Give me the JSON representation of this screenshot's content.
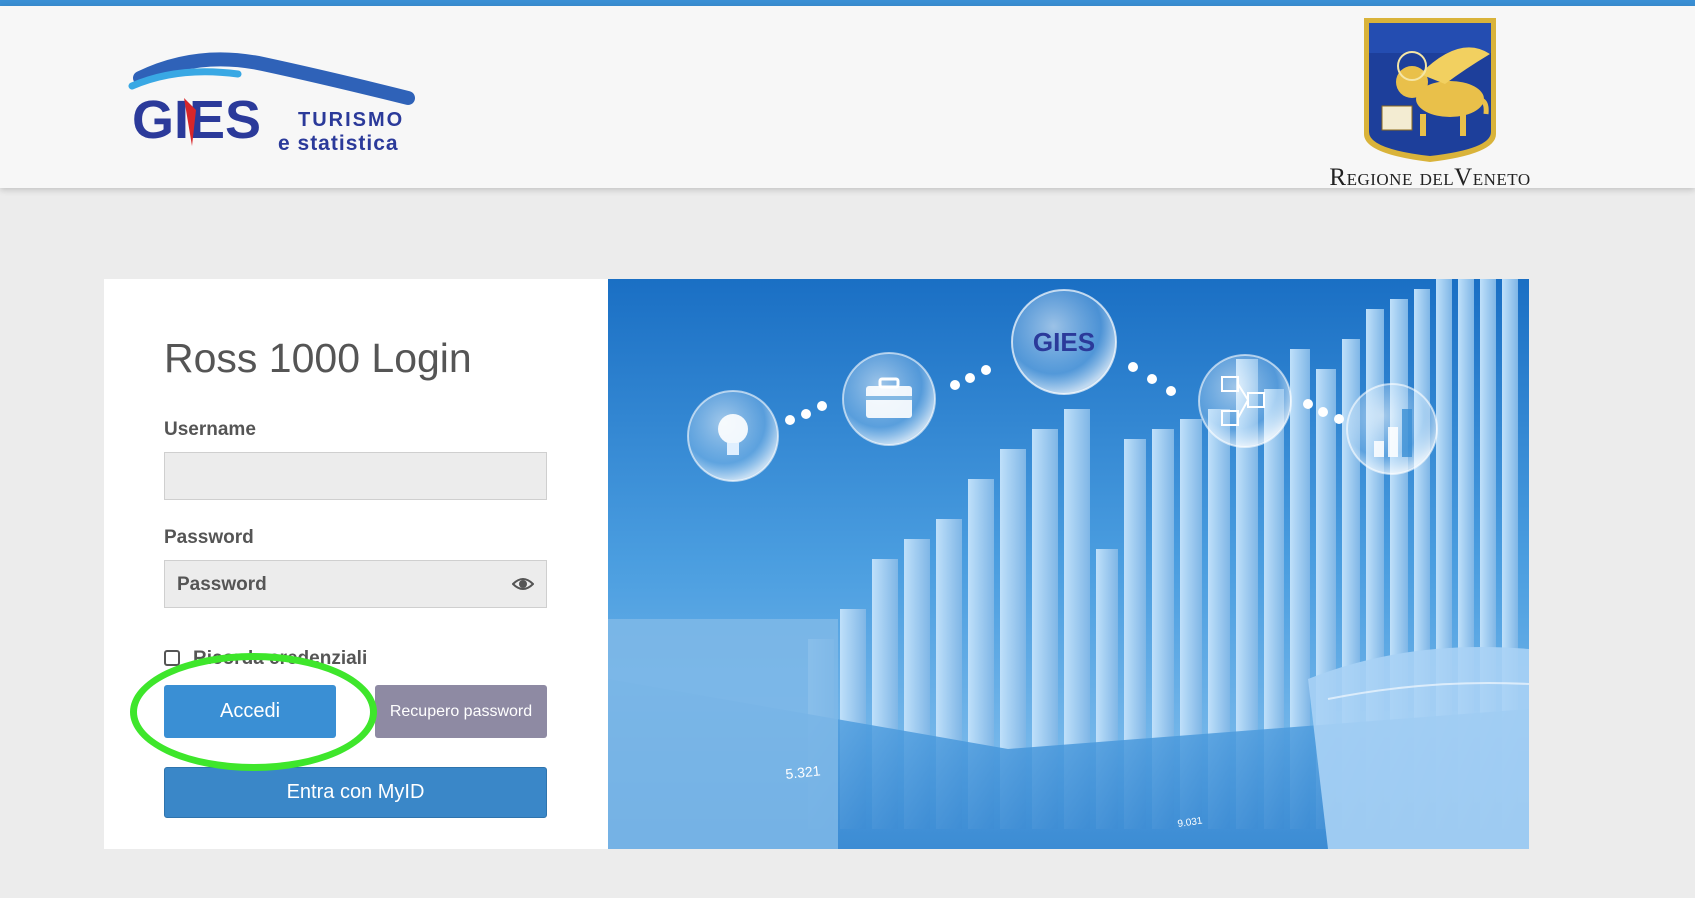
{
  "header": {
    "gies_logo": {
      "main": "GIES",
      "line1": "TURISMO",
      "line2": "e statistica"
    },
    "regione_logo": {
      "prefix_big": "R",
      "prefix_rest": "EGIONE",
      "connector": "DEL",
      "suffix_big": "V",
      "suffix_rest": "ENETO"
    }
  },
  "login": {
    "title": "Ross 1000 Login",
    "username_label": "Username",
    "username_value": "",
    "password_label": "Password",
    "password_placeholder": "Password",
    "remember_label": "Ricorda credenziali",
    "accedi_label": "Accedi",
    "recupero_label": "Recupero password",
    "myid_label": "Entra con MyID"
  },
  "hero": {
    "bubble_logo": "GIES",
    "label_a": "5.321",
    "label_b": "9.031",
    "icons": [
      "lightbulb-icon",
      "briefcase-icon",
      "network-icon",
      "bar-chart-icon"
    ]
  },
  "colors": {
    "accent": "#3a8fd4",
    "secondary_button": "#8e8aa3",
    "highlight": "#3ee62b",
    "page_bg": "#ececec"
  }
}
